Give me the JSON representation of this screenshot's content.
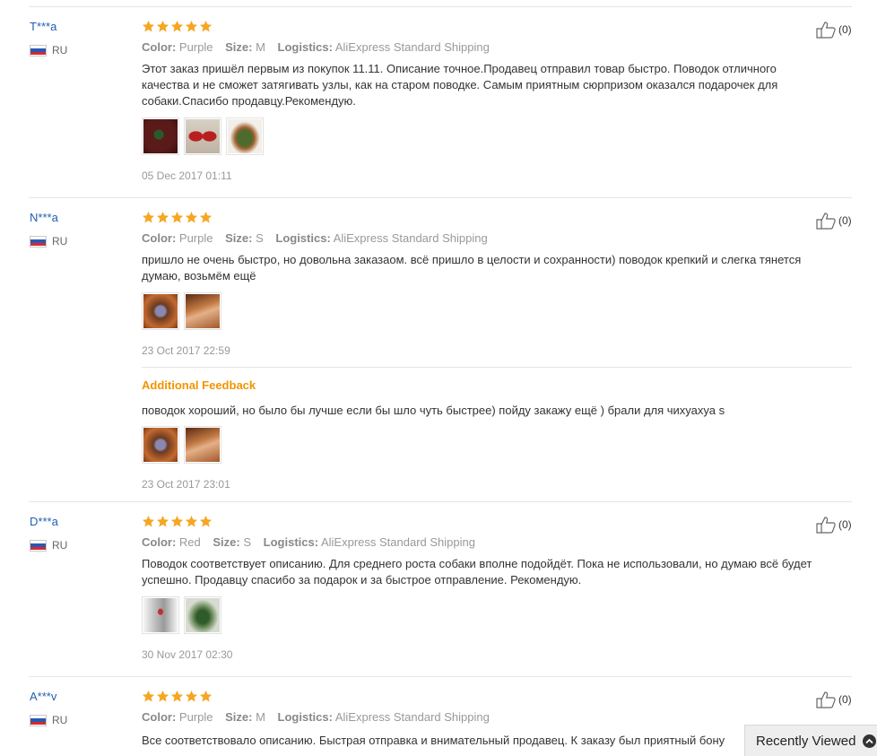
{
  "reviews": [
    {
      "user": "T***a",
      "country": "RU",
      "meta": {
        "color_label": "Color:",
        "color": "Purple",
        "size_label": "Size:",
        "size": "M",
        "logistics_label": "Logistics:",
        "logistics": "AliExpress Standard Shipping"
      },
      "text": "Этот заказ пришёл первым из покупок 11.11. Описание точное.Продавец отправил товар быстро. Поводок отличного качества и не сможет затягивать узлы, как на старом поводке. Самым приятным сюрпризом оказался подарочек для собаки.Спасибо продавцу.Рекомендую.",
      "date": "05 Dec 2017 01:11",
      "likes": "(0)",
      "rating": 5
    },
    {
      "user": "N***a",
      "country": "RU",
      "meta": {
        "color_label": "Color:",
        "color": "Purple",
        "size_label": "Size:",
        "size": "S",
        "logistics_label": "Logistics:",
        "logistics": "AliExpress Standard Shipping"
      },
      "text": "пришло не очень быстро, но довольна заказаом. всё пришло в целости и сохранности) поводок крепкий и слегка тянется думаю, возьмём ещё",
      "date": "23 Oct 2017 22:59",
      "likes": "(0)",
      "rating": 5,
      "additional": {
        "label": "Additional Feedback",
        "text": "поводок хороший, но было бы лучше если бы шло чуть быстрее) пойду закажу ещё ) брали для чихуахуа s",
        "date": "23 Oct 2017 23:01"
      }
    },
    {
      "user": "D***a",
      "country": "RU",
      "meta": {
        "color_label": "Color:",
        "color": "Red",
        "size_label": "Size:",
        "size": "S",
        "logistics_label": "Logistics:",
        "logistics": "AliExpress Standard Shipping"
      },
      "text": "Поводок соответствует описанию. Для среднего роста собаки вполне подойдёт. Пока не использовали, но думаю всё будет успешно. Продавцу спасибо за подарок и за быстрое отправление. Рекомендую.",
      "date": "30 Nov 2017 02:30",
      "likes": "(0)",
      "rating": 5
    },
    {
      "user": "A***v",
      "country": "RU",
      "meta": {
        "color_label": "Color:",
        "color": "Purple",
        "size_label": "Size:",
        "size": "M",
        "logistics_label": "Logistics:",
        "logistics": "AliExpress Standard Shipping"
      },
      "text": "Все соответствовало описанию. Быстрая отправка и внимательный продавец. К заказу был приятный бону",
      "likes": "(0)",
      "rating": 5
    }
  ],
  "recently_viewed": {
    "label": "Recently Viewed"
  },
  "colors": {
    "star": "#f5a623",
    "link": "#1f5fb4",
    "additional": "#f29400"
  }
}
